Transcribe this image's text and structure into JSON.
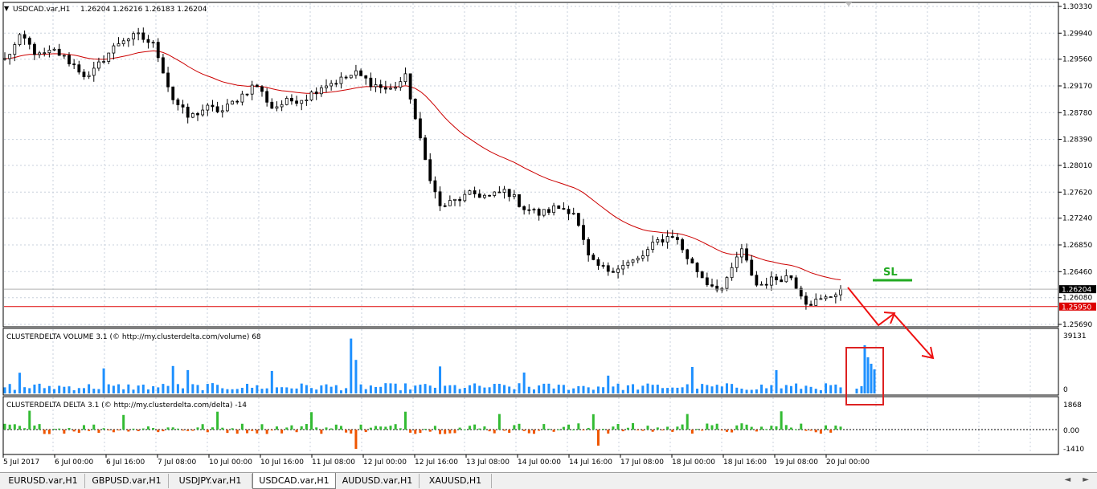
{
  "main_header": {
    "symbol": "USDCAD.var,H1",
    "ohlc": "1.26204 1.26216 1.26183 1.26204"
  },
  "price_axis": {
    "ticks": [
      "1.30330",
      "1.29940",
      "1.29560",
      "1.29170",
      "1.28780",
      "1.28390",
      "1.28010",
      "1.27620",
      "1.27240",
      "1.26850",
      "1.26460",
      "1.26080",
      "1.25690"
    ],
    "bid_label": "1.26204",
    "level_label": "1.25950"
  },
  "annotation": {
    "sl_text": "SL"
  },
  "volume_panel": {
    "title": "CLUSTERDELTA VOLUME 3.1 (© http://my.clusterdelta.com/volume) 68",
    "ticks": [
      "39131",
      "0"
    ]
  },
  "delta_panel": {
    "title": "CLUSTERDELTA DELTA 3.1 (© http://my.clusterdelta.com/delta) -14",
    "ticks": [
      "1868",
      "0.00",
      "-1410"
    ]
  },
  "time_axis": [
    "5 Jul 2017",
    "6 Jul 00:00",
    "6 Jul 16:00",
    "7 Jul 08:00",
    "10 Jul 00:00",
    "10 Jul 16:00",
    "11 Jul 08:00",
    "12 Jul 00:00",
    "12 Jul 16:00",
    "13 Jul 08:00",
    "14 Jul 00:00",
    "14 Jul 16:00",
    "17 Jul 08:00",
    "18 Jul 00:00",
    "18 Jul 16:00",
    "19 Jul 08:00",
    "20 Jul 00:00"
  ],
  "tabs": [
    {
      "label": "EURUSD.var,H1",
      "active": false
    },
    {
      "label": "GBPUSD.var,H1",
      "active": false
    },
    {
      "label": "USDJPY.var,H1",
      "active": false
    },
    {
      "label": "USDCAD.var,H1",
      "active": true
    },
    {
      "label": "AUDUSD.var,H1",
      "active": false
    },
    {
      "label": "XAUUSD,H1",
      "active": false
    }
  ],
  "tab_scroll": "◄ ►",
  "colors": {
    "moving_average": "#cc0000",
    "volume_bar": "#1e90ff",
    "delta_positive": "#33bb33",
    "delta_negative": "#ee5500",
    "sl_line": "#22aa22",
    "arrow": "#ee1111",
    "highlight_box": "#dd2222",
    "bid_label_bg": "#000000",
    "level_label_bg": "#dd0000",
    "grid": "#c8d0dc"
  },
  "chart_data": {
    "type": "candlestick",
    "symbol": "USDCAD.var,H1",
    "ylim": [
      1.2569,
      1.3033
    ],
    "close_approx": [
      1.2955,
      1.299,
      1.296,
      1.2968,
      1.295,
      1.2928,
      1.296,
      1.2985,
      1.299,
      1.2975,
      1.29,
      1.287,
      1.2885,
      1.288,
      1.29,
      1.292,
      1.2885,
      1.2895,
      1.29,
      1.2918,
      1.2925,
      1.2935,
      1.292,
      1.291,
      1.293,
      1.282,
      1.274,
      1.275,
      1.276,
      1.2755,
      1.2765,
      1.274,
      1.273,
      1.274,
      1.2735,
      1.266,
      1.2648,
      1.2655,
      1.2665,
      1.269,
      1.27,
      1.266,
      1.263,
      1.262,
      1.268,
      1.2625,
      1.2635,
      1.264,
      1.26,
      1.2605,
      1.262
    ],
    "last_price": 1.26204,
    "horizontal_level": 1.2595,
    "stop_loss_marker": "SL",
    "volume_max": 39131,
    "delta_range": [
      -1410,
      1868
    ]
  }
}
